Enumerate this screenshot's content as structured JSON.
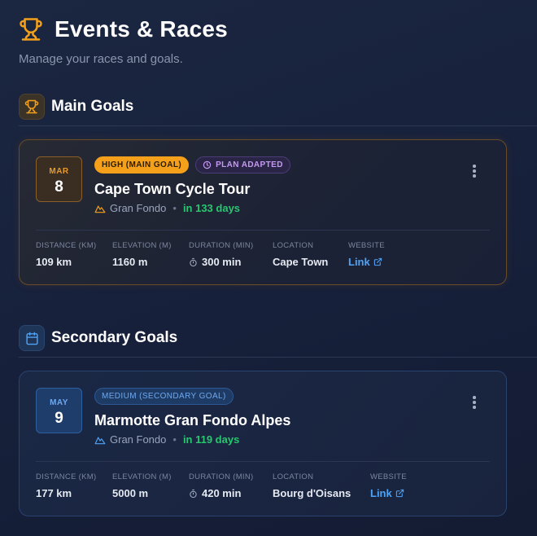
{
  "header": {
    "title": "Events & Races",
    "subtitle": "Manage your races and goals."
  },
  "colors": {
    "accent_gold": "#f5a01a",
    "accent_blue": "#4fa3f7",
    "success_green": "#28c76f",
    "plan_purple": "#c49af0",
    "background": "#16213a"
  },
  "sections": {
    "main": {
      "title": "Main Goals",
      "icon": "trophy-icon"
    },
    "secondary": {
      "title": "Secondary Goals",
      "icon": "calendar-icon"
    }
  },
  "main_event": {
    "date_month": "MAR",
    "date_day": "8",
    "priority_badge": "HIGH (MAIN GOAL)",
    "plan_badge": "PLAN ADAPTED",
    "name": "Cape Town Cycle Tour",
    "type": "Gran Fondo",
    "days_until": "in 133 days",
    "stats": {
      "distance_label": "DISTANCE (KM)",
      "distance_value": "109 km",
      "elevation_label": "ELEVATION (M)",
      "elevation_value": "1160 m",
      "duration_label": "DURATION (MIN)",
      "duration_value": "300 min",
      "location_label": "LOCATION",
      "location_value": "Cape Town",
      "website_label": "WEBSITE",
      "website_value": "Link"
    }
  },
  "secondary_event": {
    "date_month": "MAY",
    "date_day": "9",
    "priority_badge": "MEDIUM (SECONDARY GOAL)",
    "name": "Marmotte Gran Fondo Alpes",
    "type": "Gran Fondo",
    "days_until": "in 119 days",
    "stats": {
      "distance_label": "DISTANCE (KM)",
      "distance_value": "177 km",
      "elevation_label": "ELEVATION (M)",
      "elevation_value": "5000 m",
      "duration_label": "DURATION (MIN)",
      "duration_value": "420 min",
      "location_label": "LOCATION",
      "location_value": "Bourg d'Oisans",
      "website_label": "WEBSITE",
      "website_value": "Link"
    }
  },
  "meta_separator": "•"
}
